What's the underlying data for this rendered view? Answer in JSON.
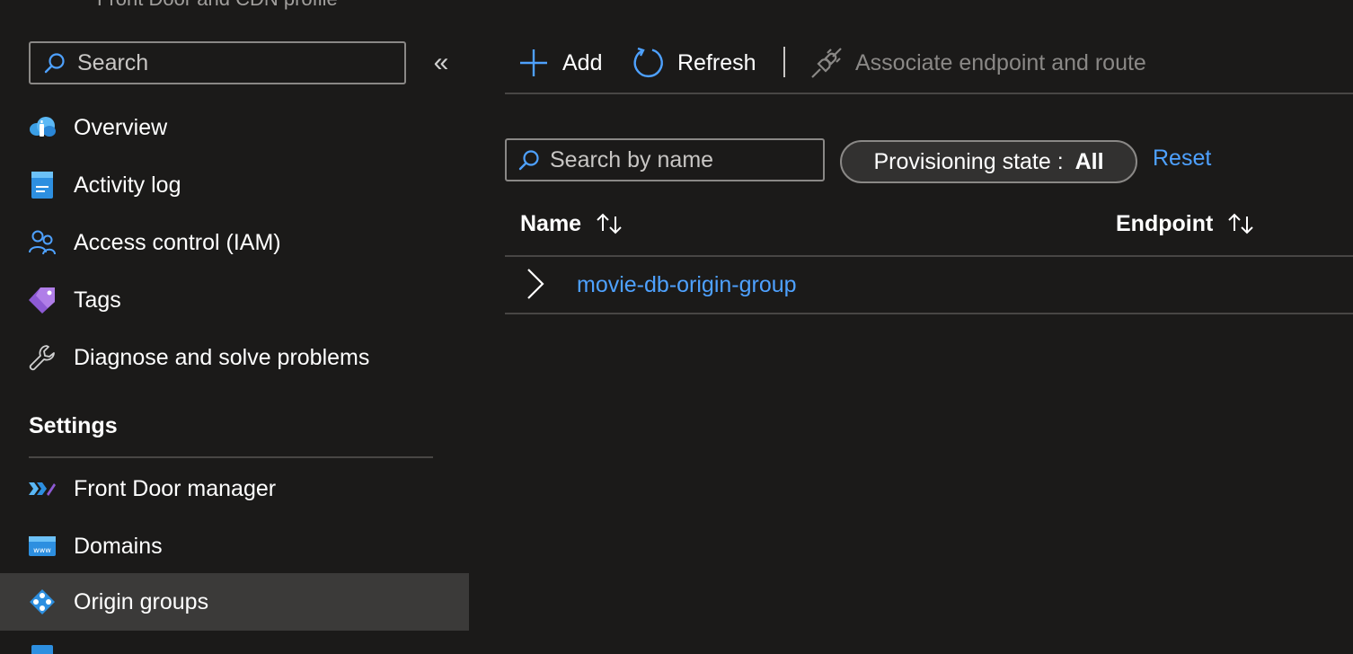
{
  "header": {
    "subtitle": "Front Door and CDN profile"
  },
  "sidebar": {
    "search_placeholder": "Search",
    "collapse_glyph": "«",
    "items": [
      {
        "label": "Overview",
        "icon": "cloud-overview-icon"
      },
      {
        "label": "Activity log",
        "icon": "activity-log-icon"
      },
      {
        "label": "Access control (IAM)",
        "icon": "people-icon"
      },
      {
        "label": "Tags",
        "icon": "tag-icon"
      },
      {
        "label": "Diagnose and solve problems",
        "icon": "wrench-icon"
      }
    ],
    "settings_header": "Settings",
    "settings_items": [
      {
        "label": "Front Door manager",
        "icon": "front-door-icon"
      },
      {
        "label": "Domains",
        "icon": "www-icon"
      },
      {
        "label": "Origin groups",
        "icon": "origin-groups-icon",
        "selected": true
      }
    ]
  },
  "toolbar": {
    "add_label": "Add",
    "refresh_label": "Refresh",
    "associate_label": "Associate endpoint and route"
  },
  "filters": {
    "search_placeholder": "Search by name",
    "provisioning_label": "Provisioning state : ",
    "provisioning_value": "All",
    "reset_label": "Reset"
  },
  "table": {
    "columns": [
      "Name",
      "Endpoint"
    ],
    "rows": [
      {
        "name": "movie-db-origin-group"
      }
    ]
  },
  "colors": {
    "background": "#1b1a19",
    "accent": "#4ea1ff",
    "selected_bg": "#3b3a39",
    "border": "#8a8886"
  }
}
